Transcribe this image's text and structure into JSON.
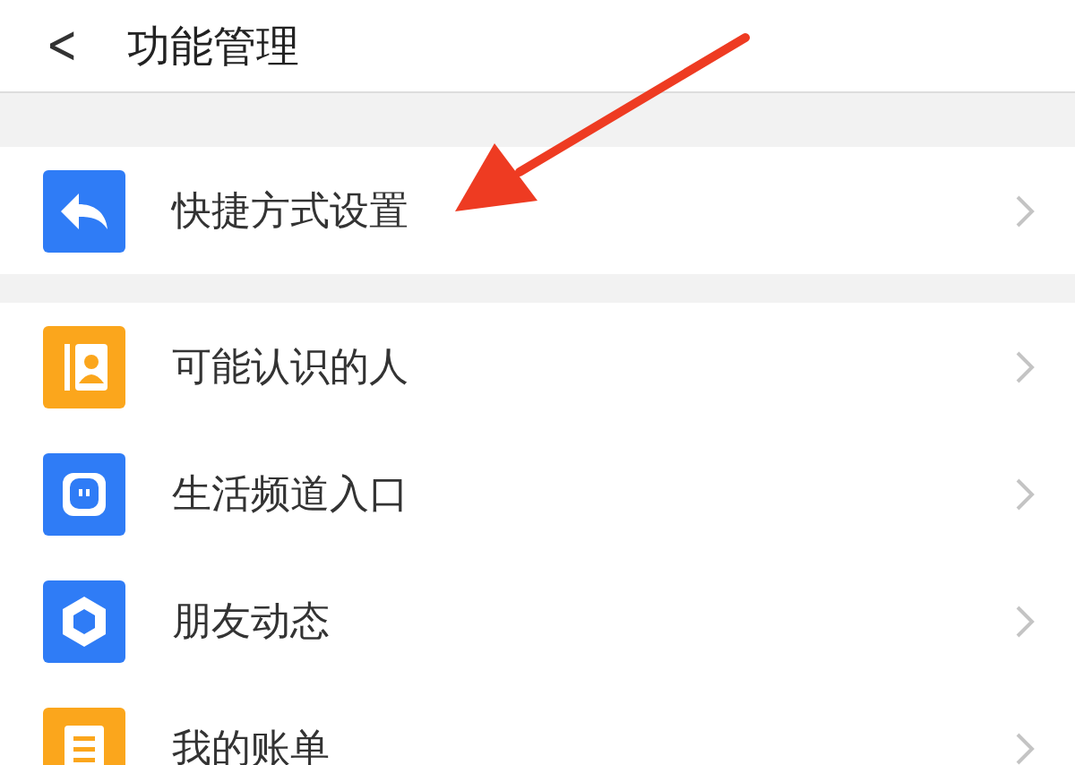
{
  "header": {
    "back": "<",
    "title": "功能管理"
  },
  "sections": [
    [
      {
        "label": "快捷方式设置",
        "kind": "reply",
        "color": "#2f7cf6"
      }
    ],
    [
      {
        "label": "可能认识的人",
        "kind": "contact",
        "color": "#fba61c"
      },
      {
        "label": "生活频道入口",
        "kind": "chat",
        "color": "#2f7cf6"
      },
      {
        "label": "朋友动态",
        "kind": "shutter",
        "color": "#2f7cf6"
      },
      {
        "label": "我的账单",
        "kind": "list",
        "color": "#fba61c"
      }
    ]
  ]
}
